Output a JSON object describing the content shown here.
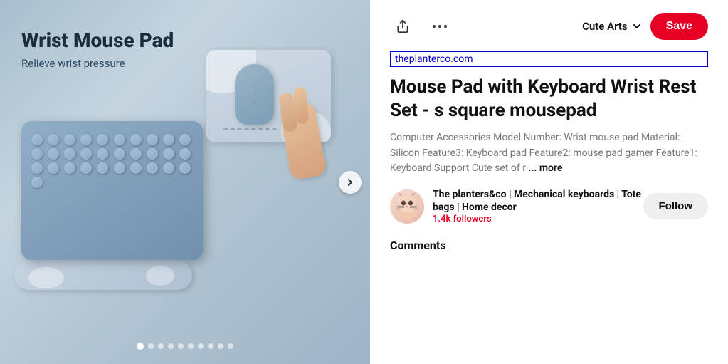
{
  "leftPanel": {
    "title": "Wrist Mouse Pad",
    "subtitle": "Relieve wrist pressure",
    "dots": [
      {
        "active": true
      },
      {
        "active": false
      },
      {
        "active": false
      },
      {
        "active": false
      },
      {
        "active": false
      },
      {
        "active": false
      },
      {
        "active": false
      },
      {
        "active": false
      },
      {
        "active": false
      },
      {
        "active": false
      }
    ],
    "nextArrow": "❯"
  },
  "toolbar": {
    "shareIcon": "⬆",
    "moreIcon": "•••",
    "boardName": "Cute Arts",
    "chevronIcon": "▼",
    "saveLabel": "Save"
  },
  "product": {
    "sourceUrl": "theplanterco.com",
    "title": "Mouse Pad with Keyboard Wrist Rest Set - s square mousepad",
    "description": "Computer Accessories Model Number: Wrist mouse pad Material: Silicon Feature3: Keyboard pad Feature2: mouse pad gamer Feature1: Keyboard Support Cute set of r",
    "moreLabel": "... more"
  },
  "profile": {
    "name": "The planters&co | Mechanical keyboards | Tote bags | Home decor",
    "followers": "1.4k followers",
    "followLabel": "Follow"
  },
  "comments": {
    "heading": "Comments"
  }
}
